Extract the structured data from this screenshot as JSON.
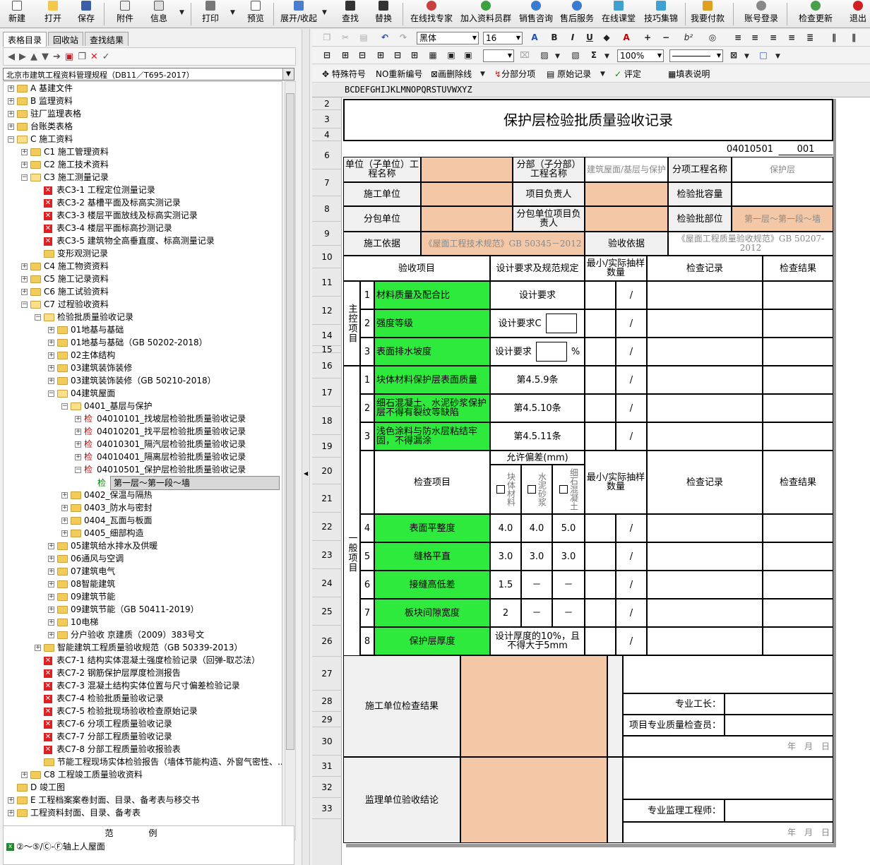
{
  "toolbar": {
    "new": "新建",
    "open": "打开",
    "save": "保存",
    "attach": "附件",
    "info": "信息",
    "print": "打印",
    "preview": "预览",
    "expand": "展开/收起",
    "find": "查找",
    "replace": "替换",
    "expert": "在线找专家",
    "group": "加入资料员群",
    "sales": "销售咨询",
    "service": "售后服务",
    "classroom": "在线课堂",
    "skills": "技巧集锦",
    "pay": "我要付款",
    "login": "账号登录",
    "update": "检查更新",
    "exit": "退出"
  },
  "left_panel": {
    "tabs": [
      "表格目录",
      "回收站",
      "查找结果"
    ],
    "spec_combo": "北京市建筑工程资料管理规程（DB11／T695-2017）",
    "tree": [
      {
        "d": 0,
        "t": "f",
        "e": "+",
        "l": "A 基建文件"
      },
      {
        "d": 0,
        "t": "f",
        "e": "+",
        "l": "B 监理资料"
      },
      {
        "d": 0,
        "t": "f",
        "e": "+",
        "l": "驻厂监理表格"
      },
      {
        "d": 0,
        "t": "f",
        "e": "+",
        "l": "台账类表格"
      },
      {
        "d": 0,
        "t": "fo",
        "e": "-",
        "l": "C 施工资料"
      },
      {
        "d": 1,
        "t": "f",
        "e": "+",
        "l": "C1 施工管理资料"
      },
      {
        "d": 1,
        "t": "f",
        "e": "+",
        "l": "C2 施工技术资料"
      },
      {
        "d": 1,
        "t": "fo",
        "e": "-",
        "l": "C3 施工测量记录"
      },
      {
        "d": 2,
        "t": "x",
        "l": "表C3-1 工程定位测量记录"
      },
      {
        "d": 2,
        "t": "x",
        "l": "表C3-2 基槽平面及标高实测记录"
      },
      {
        "d": 2,
        "t": "x",
        "l": "表C3-3 楼层平面放线及标高实测记录"
      },
      {
        "d": 2,
        "t": "x",
        "l": "表C3-4 楼层平面标高抄测记录"
      },
      {
        "d": 2,
        "t": "x",
        "l": "表C3-5 建筑物全高垂直度、标高测量记录"
      },
      {
        "d": 2,
        "t": "f",
        "l": "变形观测记录"
      },
      {
        "d": 1,
        "t": "f",
        "e": "+",
        "l": "C4 施工物资资料"
      },
      {
        "d": 1,
        "t": "f",
        "e": "+",
        "l": "C5 施工记录资料"
      },
      {
        "d": 1,
        "t": "f",
        "e": "+",
        "l": "C6 施工试验资料"
      },
      {
        "d": 1,
        "t": "fo",
        "e": "-",
        "l": "C7 过程验收资料"
      },
      {
        "d": 2,
        "t": "fo",
        "e": "-",
        "l": "检验批质量验收记录"
      },
      {
        "d": 3,
        "t": "f",
        "e": "+",
        "l": "01地基与基础"
      },
      {
        "d": 3,
        "t": "f",
        "e": "+",
        "l": "01地基与基础（GB 50202-2018）"
      },
      {
        "d": 3,
        "t": "f",
        "e": "+",
        "l": "02主体结构"
      },
      {
        "d": 3,
        "t": "f",
        "e": "+",
        "l": "03建筑装饰装修"
      },
      {
        "d": 3,
        "t": "f",
        "e": "+",
        "l": "03建筑装饰装修（GB 50210-2018）"
      },
      {
        "d": 3,
        "t": "fo",
        "e": "-",
        "l": "04建筑屋面"
      },
      {
        "d": 4,
        "t": "fo",
        "e": "-",
        "l": "0401_基层与保护"
      },
      {
        "d": 5,
        "t": "j",
        "e": "+",
        "l": "04010101_找坡层检验批质量验收记录"
      },
      {
        "d": 5,
        "t": "j",
        "e": "+",
        "l": "04010201_找平层检验批质量验收记录"
      },
      {
        "d": 5,
        "t": "j",
        "e": "+",
        "l": "04010301_隔汽层检验批质量验收记录"
      },
      {
        "d": 5,
        "t": "j",
        "e": "+",
        "l": "04010401_隔离层检验批质量验收记录"
      },
      {
        "d": 5,
        "t": "j",
        "e": "-",
        "l": "04010501_保护层检验批质量验收记录"
      },
      {
        "d": 6,
        "t": "jf",
        "sel": true,
        "l": "第一层～第一段～墙"
      },
      {
        "d": 4,
        "t": "f",
        "e": "+",
        "l": "0402_保温与隔热"
      },
      {
        "d": 4,
        "t": "f",
        "e": "+",
        "l": "0403_防水与密封"
      },
      {
        "d": 4,
        "t": "f",
        "e": "+",
        "l": "0404_瓦面与板面"
      },
      {
        "d": 4,
        "t": "f",
        "e": "+",
        "l": "0405_细部构造"
      },
      {
        "d": 3,
        "t": "f",
        "e": "+",
        "l": "05建筑给水排水及供暖"
      },
      {
        "d": 3,
        "t": "f",
        "e": "+",
        "l": "06通风与空调"
      },
      {
        "d": 3,
        "t": "f",
        "e": "+",
        "l": "07建筑电气"
      },
      {
        "d": 3,
        "t": "f",
        "e": "+",
        "l": "08智能建筑"
      },
      {
        "d": 3,
        "t": "f",
        "e": "+",
        "l": "09建筑节能"
      },
      {
        "d": 3,
        "t": "f",
        "e": "+",
        "l": "09建筑节能（GB 50411-2019）"
      },
      {
        "d": 3,
        "t": "f",
        "e": "+",
        "l": "10电梯"
      },
      {
        "d": 3,
        "t": "f",
        "e": "+",
        "l": "分户验收 京建质（2009）383号文"
      },
      {
        "d": 2,
        "t": "f",
        "e": "+",
        "l": "智能建筑工程质量验收规范（GB 50339-2013）"
      },
      {
        "d": 2,
        "t": "x",
        "l": "表C7-1 结构实体混凝土强度检验记录（回弹-取芯法）"
      },
      {
        "d": 2,
        "t": "x",
        "l": "表C7-2 钢筋保护层厚度检测报告"
      },
      {
        "d": 2,
        "t": "x",
        "l": "表C7-3 混凝土结构实体位置与尺寸偏差检验记录"
      },
      {
        "d": 2,
        "t": "x",
        "l": "表C7-4 检验批质量验收记录"
      },
      {
        "d": 2,
        "t": "x",
        "l": "表C7-5 检验批现场验收检查原始记录"
      },
      {
        "d": 2,
        "t": "x",
        "l": "表C7-6 分项工程质量验收记录"
      },
      {
        "d": 2,
        "t": "x",
        "l": "表C7-7 分部工程质量验收记录"
      },
      {
        "d": 2,
        "t": "x",
        "l": "表C7-8 分部工程质量验收报验表"
      },
      {
        "d": 2,
        "t": "f",
        "l": "节能工程现场实体检验报告（墙体节能构造、外窗气密性、..."
      },
      {
        "d": 1,
        "t": "f",
        "e": "+",
        "l": "C8 工程竣工质量验收资料"
      },
      {
        "d": 0,
        "t": "f",
        "l": "D 竣工图"
      },
      {
        "d": 0,
        "t": "f",
        "e": "+",
        "l": "E 工程档案案卷封面、目录、备考表与移交书"
      },
      {
        "d": 0,
        "t": "f",
        "e": "+",
        "l": "工程资料封面、目录、备考表"
      }
    ],
    "legend_title": "范例",
    "legend_item": "②～⑤/Ⓒ-Ⓕ轴上人屋面"
  },
  "format_toolbar": {
    "font": "黑体",
    "size": "16",
    "zoom": "100%"
  },
  "toolbar3": {
    "special": "特殊符号",
    "renumber": "重新编号",
    "diag": "画删除线",
    "split": "分部分项",
    "raw": "原始记录",
    "eval": "评定",
    "guide": "填表说明"
  },
  "sheet": {
    "col_letters": "BCDEFGHIJKLMNOPQRSTUVWXYZ",
    "row_numbers": [
      "2",
      "3",
      "4",
      "6",
      "7",
      "8",
      "9",
      "10",
      "11",
      "12",
      "14",
      "15",
      "16",
      "17",
      "18",
      "19",
      "20",
      "21",
      "22",
      "23",
      "24",
      "25",
      "26",
      "27",
      "28",
      "29",
      "30",
      "31",
      "32",
      "33"
    ],
    "title": "保护层检验批质量验收记录",
    "code": "04010501",
    "code_no": "001",
    "labels": {
      "unit": "单位（子单位）工程名称",
      "div": "分部（子分部）工程名称",
      "div_val": "建筑屋面/基层与保护",
      "subitem": "分项工程名称",
      "subitem_val": "保护层",
      "contractor": "施工单位",
      "pm": "项目负责人",
      "capacity": "检验批容量",
      "sub": "分包单位",
      "sub_pm": "分包单位项目负责人",
      "part": "检验批部位",
      "part_val": "第一层～第一段～墙",
      "basis": "施工依据",
      "basis_val": "《屋面工程技术规范》GB 50345－2012",
      "accept_basis": "验收依据",
      "accept_val": "《屋面工程质量验收规范》GB 50207-2012",
      "item": "验收项目",
      "design": "设计要求及规范规定",
      "sample": "最小/实际抽样数量",
      "record": "检查记录",
      "result": "检查结果",
      "main": "主控项目",
      "general": "一般项目",
      "allow": "允许偏差(mm)",
      "check_item": "检查项目",
      "mat1": "块体材料",
      "mat2": "水泥砂浆",
      "mat3": "细石混凝土",
      "slash": "/",
      "con_unit": "施工单位检查结果",
      "foreman": "专业工长：",
      "qc": "项目专业质量检查员：",
      "date": "年　月　日",
      "sup_unit": "监理单位验收结论",
      "engineer": "专业监理工程师："
    },
    "main_items": [
      {
        "n": "1",
        "name": "材料质量及配合比",
        "req": "设计要求"
      },
      {
        "n": "2",
        "name": "强度等级",
        "req": "设计要求C"
      },
      {
        "n": "3",
        "name": "表面排水坡度",
        "req": "设计要求",
        "unit": "%"
      }
    ],
    "gen_items_a": [
      {
        "n": "1",
        "name": "块体材料保护层表面质量",
        "req": "第4.5.9条"
      },
      {
        "n": "2",
        "name": "细石混凝土、水泥砂浆保护层不得有裂纹等缺陷",
        "req": "第4.5.10条"
      },
      {
        "n": "3",
        "name": "浅色涂料与防水层粘结牢固，不得漏涂",
        "req": "第4.5.11条"
      }
    ],
    "gen_items_b": [
      {
        "n": "4",
        "name": "表面平整度",
        "v": [
          "4.0",
          "4.0",
          "5.0"
        ]
      },
      {
        "n": "5",
        "name": "缝格平直",
        "v": [
          "3.0",
          "3.0",
          "3.0"
        ]
      },
      {
        "n": "6",
        "name": "接缝高低差",
        "v": [
          "1.5",
          "－",
          "－"
        ]
      },
      {
        "n": "7",
        "name": "板块间隙宽度",
        "v": [
          "2",
          "－",
          "－"
        ]
      },
      {
        "n": "8",
        "name": "保护层厚度",
        "v": [
          "设计厚度的10%，且不得大于5mm"
        ]
      }
    ]
  }
}
